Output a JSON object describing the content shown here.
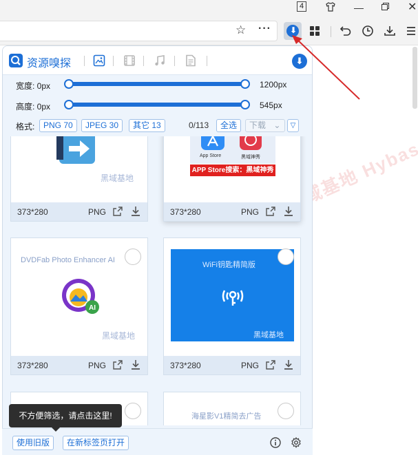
{
  "browser": {
    "tab_count_badge": "4"
  },
  "panel": {
    "title": "资源嗅探",
    "filters": {
      "width_label": "宽度: 0px",
      "width_max": "1200px",
      "height_label": "高度: 0px",
      "height_max": "545px",
      "format_label": "格式:",
      "chips": [
        "PNG 70",
        "JPEG 30",
        "其它 13"
      ],
      "count": "0/113",
      "select_all": "全选",
      "download": "下载"
    },
    "cards": [
      {
        "dimensions": "373*280",
        "format": "PNG",
        "watermark": "黑域基地"
      },
      {
        "dimensions": "373*280",
        "format": "PNG",
        "store_text": "APP Store搜索：黑域神秀",
        "app_store_label": "App Store",
        "sub_label": "黑域神秀"
      },
      {
        "dimensions": "373*280",
        "format": "PNG",
        "caption": "DVDFab Photo Enhancer AI",
        "badge": "AI",
        "watermark": "黑域基地"
      },
      {
        "dimensions": "373*280",
        "format": "PNG",
        "caption": "WiFi钥匙精简版",
        "watermark": "黑域基地"
      },
      {
        "caption": "海星影V1精简去广告"
      }
    ],
    "tooltip": "不方便筛选，请点击这里!",
    "bottom": {
      "old_version": "使用旧版",
      "open_new_tab": "在新标签页打开"
    }
  },
  "page_watermark": "记得收藏黑域基地 Hybase.c",
  "colors": {
    "accent": "#1d6fd6",
    "annotation_arrow": "#d62a2a"
  }
}
